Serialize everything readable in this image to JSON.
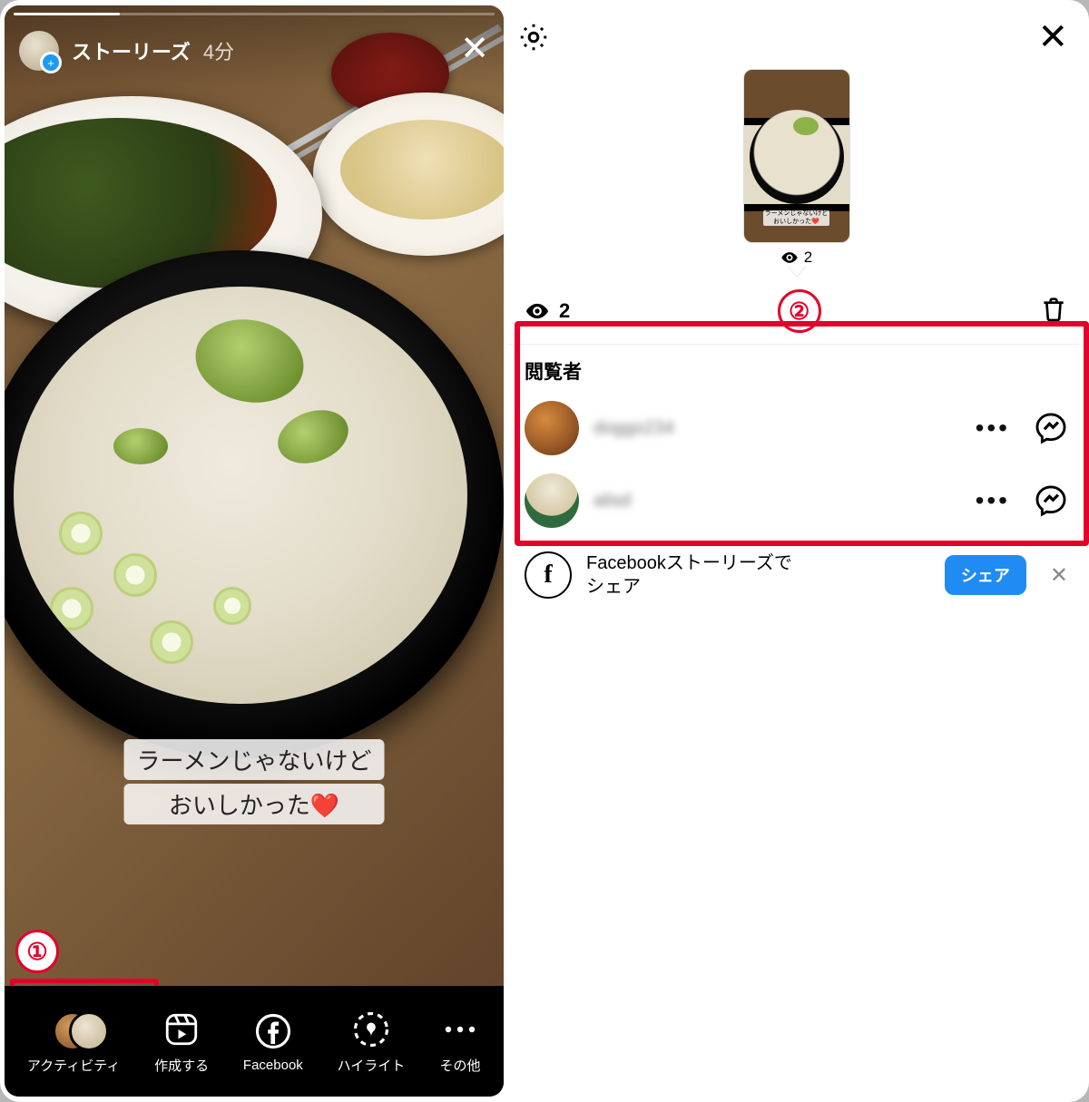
{
  "left": {
    "header": {
      "title": "ストーリーズ",
      "time": "4分"
    },
    "caption": {
      "line1": "ラーメンじゃないけど",
      "line2": "おいしかった❤️"
    },
    "tabs": {
      "activity": "アクティビティ",
      "create": "作成する",
      "facebook": "Facebook",
      "highlight": "ハイライト",
      "more": "その他"
    },
    "annotation1": "①"
  },
  "right": {
    "thumb_caption": {
      "l1": "ラーメンじゃないけど",
      "l2": "おいしかった❤️"
    },
    "thumb_views": "2",
    "views_count": "2",
    "annotation2": "②",
    "viewers_title": "閲覧者",
    "viewers": [
      {
        "name": "doggo234"
      },
      {
        "name": "alisd"
      }
    ],
    "fb_share": {
      "line1": "Facebookストーリーズで",
      "line2": "シェア",
      "button": "シェア"
    }
  }
}
